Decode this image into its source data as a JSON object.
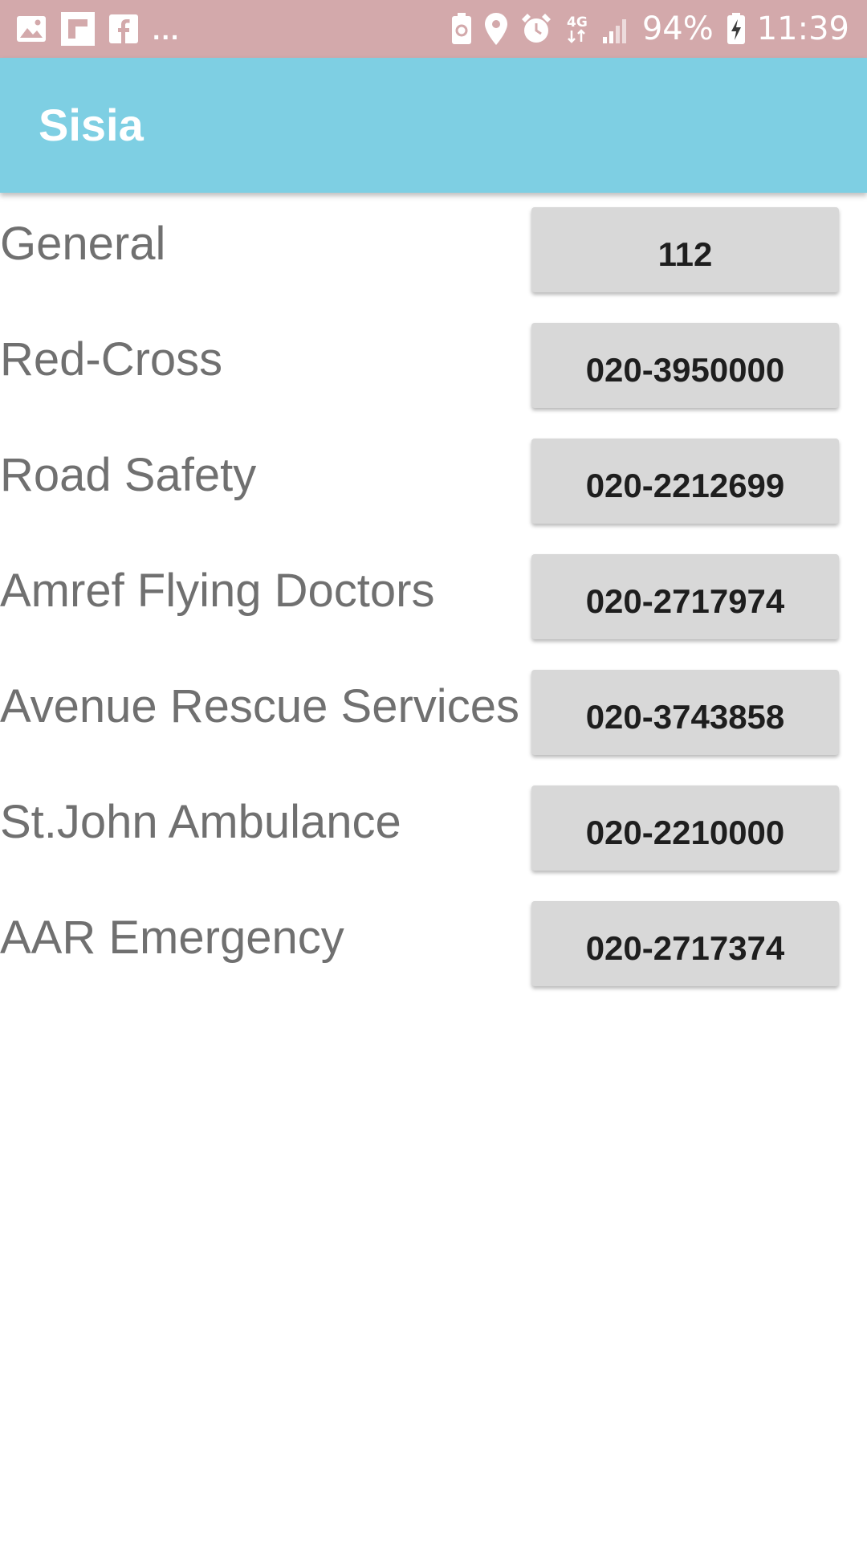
{
  "status_bar": {
    "left_icons": [
      "image-icon",
      "flipboard-icon",
      "facebook-icon"
    ],
    "more_indicator": "...",
    "right_icons": [
      "battery-saver-icon",
      "location-icon",
      "alarm-icon",
      "network-4g-icon",
      "signal-icon",
      "battery-charging-icon"
    ],
    "network_type": "4G",
    "battery": "94%",
    "time": "11:39"
  },
  "app_bar": {
    "title": "Sisia",
    "color": "#7ecfe3"
  },
  "contacts": [
    {
      "label": "General",
      "number": "112"
    },
    {
      "label": "Red-Cross",
      "number": "020-3950000"
    },
    {
      "label": "Road Safety",
      "number": "020-2212699"
    },
    {
      "label": "Amref Flying Doctors",
      "number": "020-2717974"
    },
    {
      "label": "Avenue Rescue Services",
      "number": "020-3743858"
    },
    {
      "label": "St.John Ambulance",
      "number": "020-2210000"
    },
    {
      "label": "AAR Emergency",
      "number": "020-2717374"
    }
  ]
}
